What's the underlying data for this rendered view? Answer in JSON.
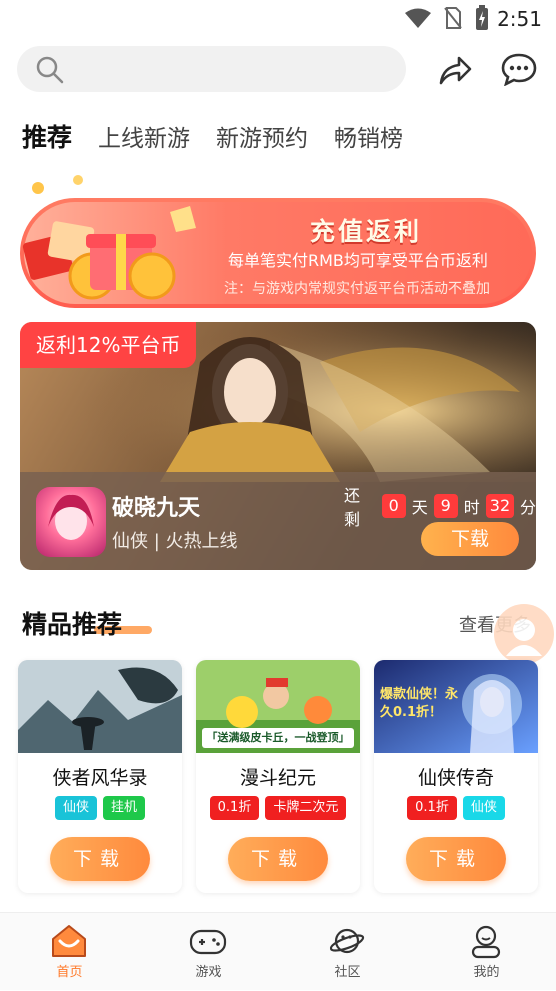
{
  "status_bar": {
    "time": "2:51",
    "icons": [
      "wifi-icon",
      "no-sim-icon",
      "battery-charging-icon"
    ]
  },
  "search": {
    "placeholder": "",
    "icon": "search-icon"
  },
  "header_actions": {
    "share_icon": "share-icon",
    "message_icon": "message-icon"
  },
  "tabs": [
    {
      "label": "推荐",
      "active": true
    },
    {
      "label": "上线新游",
      "active": false
    },
    {
      "label": "新游预约",
      "active": false
    },
    {
      "label": "畅销榜",
      "active": false
    }
  ],
  "banner": {
    "title": "充值返利",
    "subtitle": "每单笔实付RMB均可享受平台币返利",
    "note": "注：与游戏内常规实付返平台币活动不叠加"
  },
  "featured": {
    "tag": "返利12%平台币",
    "name": "破晓九天",
    "meta": "仙侠 | 火热上线",
    "countdown": {
      "prefix": "还剩",
      "days": "0",
      "days_unit": "天",
      "hours": "9",
      "hours_unit": "时",
      "minutes": "32",
      "minutes_unit": "分"
    },
    "download_label": "下载"
  },
  "section": {
    "title": "精品推荐",
    "more_label": "查看更多"
  },
  "games": [
    {
      "name": "侠者风华录",
      "tags": [
        {
          "label": "仙侠",
          "color": "#19c3d8"
        },
        {
          "label": "挂机",
          "color": "#1ec84a"
        }
      ],
      "download_label": "下载"
    },
    {
      "name": "漫斗纪元",
      "cover_text": "「送满级皮卡丘，一战登顶」",
      "tags": [
        {
          "label": "0.1折",
          "color": "#f02020"
        },
        {
          "label": "卡牌二次元",
          "color": "#f02020"
        }
      ],
      "download_label": "下载"
    },
    {
      "name": "仙侠传奇",
      "cover_text": "爆款仙侠！永久0.1折！",
      "tags": [
        {
          "label": "0.1折",
          "color": "#f02020"
        },
        {
          "label": "仙侠",
          "color": "#19d8e8"
        }
      ],
      "download_label": "下载"
    }
  ],
  "bottom_nav": [
    {
      "label": "首页",
      "icon": "home-icon",
      "active": true
    },
    {
      "label": "游戏",
      "icon": "gamepad-icon",
      "active": false
    },
    {
      "label": "社区",
      "icon": "planet-icon",
      "active": false
    },
    {
      "label": "我的",
      "icon": "profile-icon",
      "active": false
    }
  ],
  "colors": {
    "accent": "#ff7a2a",
    "tag_red": "#ff3b3b",
    "banner": "#ff6a58"
  }
}
